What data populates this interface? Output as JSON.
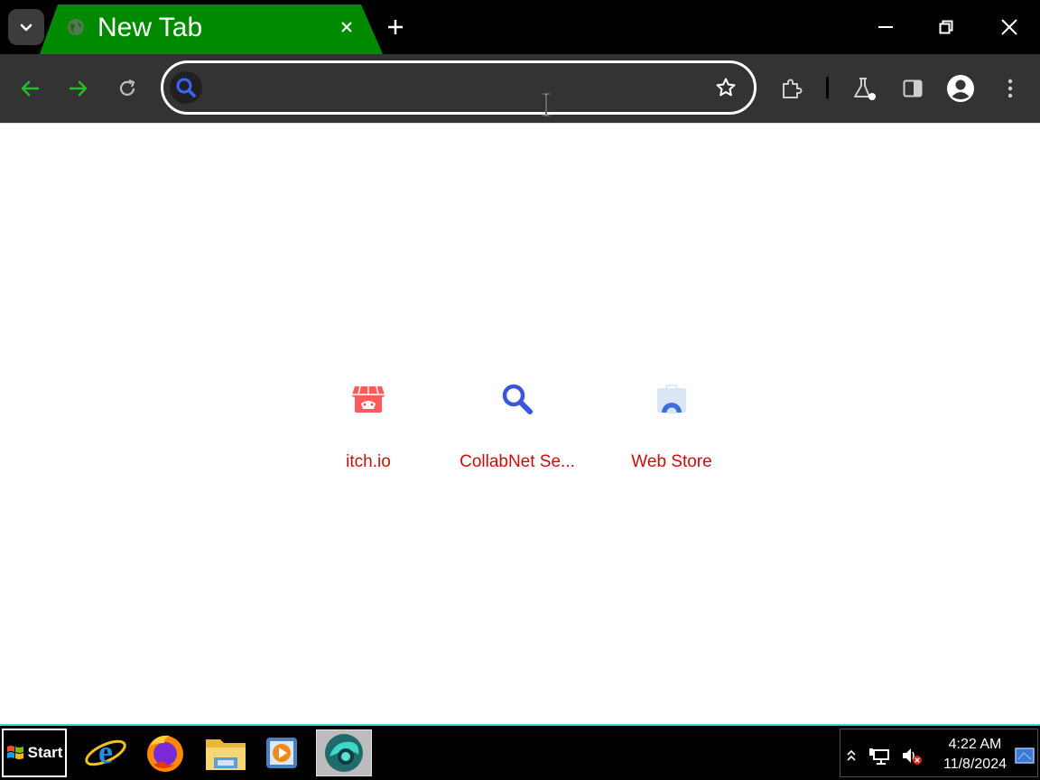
{
  "titlebar": {
    "tab_title": "New Tab",
    "tab_search_icon": "chevron-down-icon",
    "close_tab_icon": "close-icon",
    "new_tab_icon": "plus-icon",
    "window_controls": [
      "minimize-icon",
      "restore-icon",
      "close-icon"
    ]
  },
  "toolbar": {
    "back_icon": "arrow-left-icon",
    "forward_icon": "arrow-right-icon",
    "reload_icon": "reload-icon",
    "omnibox_value": "",
    "bookmark_icon": "star-icon",
    "right_icons": [
      "extensions-icon",
      "labs-icon",
      "side-panel-icon",
      "profile-icon",
      "menu-icon"
    ]
  },
  "shortcuts": [
    {
      "label": "itch.io",
      "icon": "itch-io-icon"
    },
    {
      "label": "CollabNet Se...",
      "icon": "search-icon"
    },
    {
      "label": "Web Store",
      "icon": "web-store-icon"
    }
  ],
  "taskbar": {
    "start_label": "Start",
    "apps": [
      "internet-explorer-icon",
      "firefox-icon",
      "file-explorer-icon",
      "media-player-icon",
      "browser-app-icon"
    ],
    "clock_time": "4:22 AM",
    "clock_date": "11/8/2024"
  },
  "colors": {
    "tab_active": "#008a00",
    "nav_arrows": "#22c022",
    "shortcut_label": "#d10a0a",
    "taskbar_border": "#3fd0d8"
  }
}
